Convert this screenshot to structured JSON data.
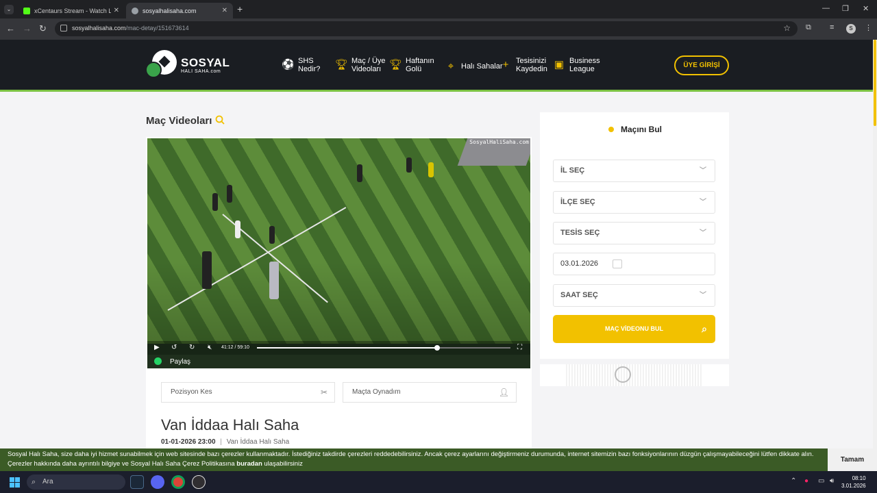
{
  "browser": {
    "tabs": [
      {
        "title": "xCentaurs Stream - Watch Live",
        "active": false
      },
      {
        "title": "sosyalhalisaha.com",
        "active": true
      }
    ],
    "url_host": "sosyalhalisaha.com",
    "url_path": "/mac-detay/151673614",
    "profile_initial": "S"
  },
  "header": {
    "logo_title": "SOSYAL",
    "logo_subtitle": "HALI SAHA.com",
    "nav": [
      {
        "line1": "SHS",
        "line2": "Nedir?"
      },
      {
        "line1": "Maç / Üye",
        "line2": "Videoları"
      },
      {
        "line1": "Haftanın",
        "line2": "Golü"
      },
      {
        "line1": "Halı Sahalar",
        "line2": ""
      },
      {
        "line1": "Tesisinizi",
        "line2": "Kaydedin"
      },
      {
        "line1": "Business",
        "line2": "League"
      }
    ],
    "login_label": "ÜYE GİRİŞİ"
  },
  "main": {
    "section_title": "Maç Videoları",
    "video": {
      "watermark": "SosyalHaliSaha.com",
      "timecode": "41:12 / 59:10",
      "progress": 0.71,
      "share_label": "Paylaş"
    },
    "actions": [
      {
        "label": "Pozisyon Kes"
      },
      {
        "label": "Maçta Oynadım"
      }
    ],
    "match_title": "Van İddaa Halı Saha",
    "match_date": "01-01-2026 23:00",
    "match_venue": "Van İddaa Halı Saha"
  },
  "finder": {
    "title": "Maçını Bul",
    "il": "İL SEÇ",
    "ilce": "İLÇE SEÇ",
    "tesis": "TESİS SEÇ",
    "date": "03.01.2026",
    "saat": "SAAT SEÇ",
    "button": "MAÇ VİDEONU BUL"
  },
  "cookie": {
    "text_before": "Sosyal Halı Saha, size daha iyi hizmet sunabilmek için web sitesinde bazı çerezler kullanmaktadır. İstediğiniz takdirde çerezleri reddedebilirsiniz. Ancak çerez ayarlarını değiştirmeniz durumunda, internet sitemizin bazı fonksiyonlarının düzgün çalışmayabileceğini lütfen dikkate alın. Çerezler hakkında daha ayrıntılı bilgiye ve Sosyal Halı Saha Çerez Politikasına ",
    "link": "buradan",
    "text_after": " ulaşabilirsiniz",
    "ok": "Tamam"
  },
  "taskbar": {
    "search_placeholder": "Ara",
    "time": "08:10",
    "date": "3.01.2026"
  },
  "colors": {
    "accent": "#f2c100",
    "header_bg": "#1a1d22",
    "header_border": "#7cc243",
    "cookie_bg": "#3b5b26"
  }
}
